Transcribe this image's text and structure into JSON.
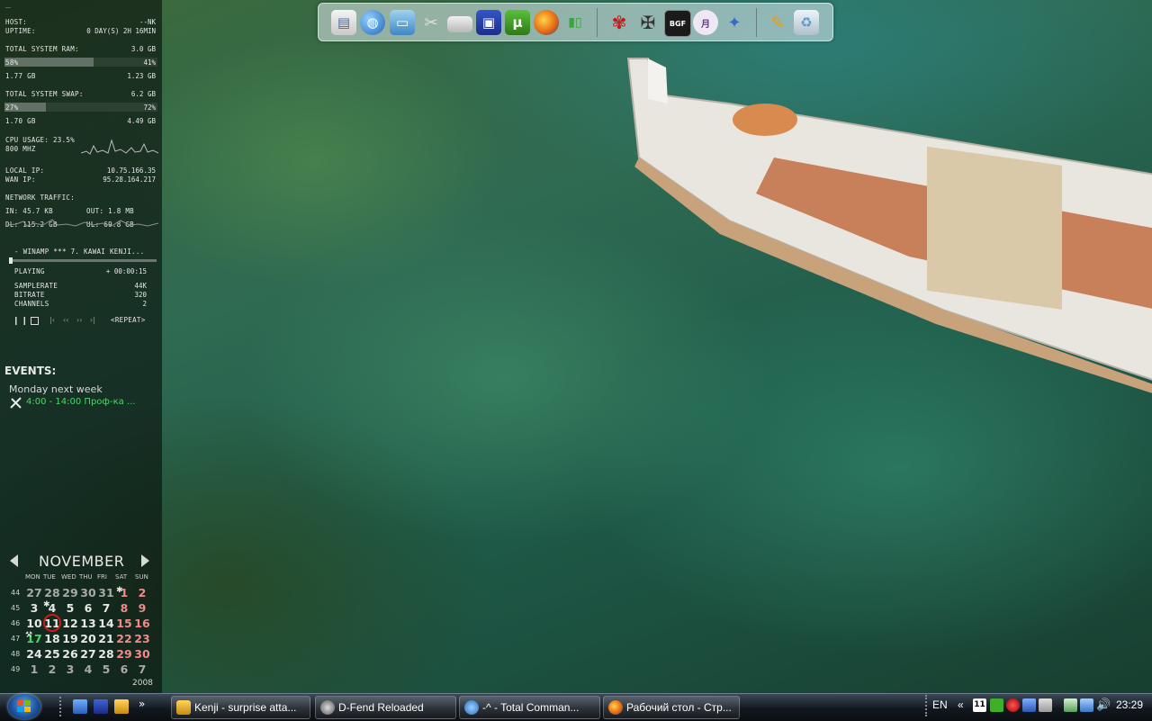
{
  "sysmon": {
    "host_label": "HOST:",
    "host_value": "--NK",
    "uptime_label": "UPTIME:",
    "uptime_value": "0 DAY(S) 2H 16MIN",
    "ram_label": "TOTAL SYSTEM RAM:",
    "ram_total": "3.0 GB",
    "ram_used_pct": "58%",
    "ram_free_pct": "41%",
    "ram_used_fraction": 0.58,
    "ram_used": "1.77 GB",
    "ram_free": "1.23 GB",
    "swap_label": "TOTAL SYSTEM SWAP:",
    "swap_total": "6.2 GB",
    "swap_used_pct": "27%",
    "swap_free_pct": "72%",
    "swap_used_fraction": 0.27,
    "swap_used": "1.70 GB",
    "swap_free": "4.49 GB",
    "cpu_label": "CPU USAGE: 23.5%",
    "cpu_freq": "800 MHZ",
    "local_ip_label": "LOCAL IP:",
    "local_ip": "10.75.166.35",
    "wan_ip_label": "WAN IP:",
    "wan_ip": "95.28.164.217",
    "net_label": "NETWORK TRAFFIC:",
    "net_in": "IN: 45.7 KB",
    "net_out": "OUT: 1.8 MB",
    "net_dl": "DL: 115.2 GB",
    "net_ul": "UL: 69.8 GB"
  },
  "winamp": {
    "title": "- WINAMP *** 7. KAWAI KENJI...",
    "status": "PLAYING",
    "time": "+ 00:00:15",
    "samplerate_label": "SAMPLERATE",
    "samplerate": "44K",
    "bitrate_label": "BITRATE",
    "bitrate": "320",
    "channels_label": "CHANNELS",
    "channels": "2",
    "repeat": "<REPEAT>"
  },
  "events": {
    "title": "EVENTS:",
    "day": "Monday next week",
    "item": "4:00 - 14:00 Проф-ка ..."
  },
  "calendar": {
    "month": "NOVEMBER",
    "year": "2008",
    "days_header": [
      "MON",
      "TUE",
      "WED",
      "THU",
      "FRI",
      "SAT",
      "SUN"
    ],
    "weeks": [
      {
        "num": "44",
        "days": [
          "27",
          "28",
          "29",
          "30",
          "31",
          "1",
          "2"
        ]
      },
      {
        "num": "45",
        "days": [
          "3",
          "4",
          "5",
          "6",
          "7",
          "8",
          "9"
        ]
      },
      {
        "num": "46",
        "days": [
          "10",
          "11",
          "12",
          "13",
          "14",
          "15",
          "16"
        ]
      },
      {
        "num": "47",
        "days": [
          "17",
          "18",
          "19",
          "20",
          "21",
          "22",
          "23"
        ]
      },
      {
        "num": "48",
        "days": [
          "24",
          "25",
          "26",
          "27",
          "28",
          "29",
          "30"
        ]
      },
      {
        "num": "49",
        "days": [
          "1",
          "2",
          "3",
          "4",
          "5",
          "6",
          "7"
        ]
      }
    ],
    "today": "11",
    "weekend_color": "#f28a8a",
    "other_month_color": "#a9a9a9",
    "today_ring_color": "#d01818"
  },
  "dock": {
    "icons": [
      "document-icon",
      "globe-icon",
      "folder-icon",
      "tools-icon",
      "drive-icon",
      "floppy-icon",
      "utorrent-icon",
      "firefox-icon",
      "network-icon",
      "anime-figure-icon",
      "mech-figure-icon",
      "bgf-avatar-icon",
      "kanji-icon",
      "gamepad-icon",
      "settings-icon",
      "recycle-bin-icon"
    ]
  },
  "taskbar": {
    "tasks": [
      {
        "label": "Kenji - surprise atta...",
        "icon": "winamp-icon"
      },
      {
        "label": "D-Fend Reloaded",
        "icon": "gear-icon"
      },
      {
        "label": "-^ - Total Comman...",
        "icon": "total-commander-icon"
      },
      {
        "label": "Рабочий стол - Стр...",
        "icon": "firefox-icon"
      }
    ],
    "language": "EN",
    "time": "23:29",
    "chevron": "»",
    "tray_chevron": "«"
  }
}
